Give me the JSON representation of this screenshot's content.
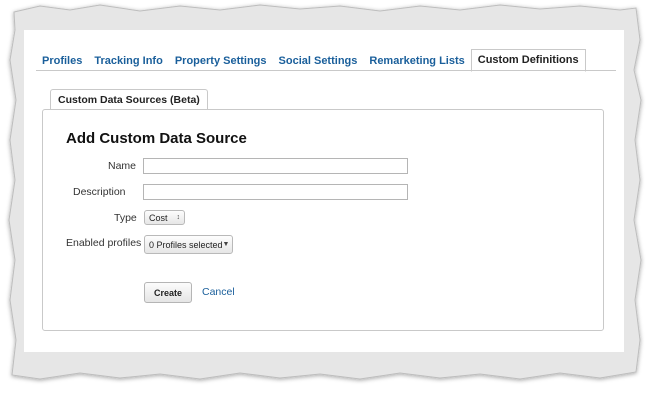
{
  "tabs": [
    {
      "label": "Profiles",
      "active": false
    },
    {
      "label": "Tracking Info",
      "active": false
    },
    {
      "label": "Property Settings",
      "active": false
    },
    {
      "label": "Social Settings",
      "active": false
    },
    {
      "label": "Remarketing Lists",
      "active": false
    },
    {
      "label": "Custom Definitions",
      "active": true
    }
  ],
  "subtab": {
    "label": "Custom Data Sources (Beta)"
  },
  "form": {
    "title": "Add Custom Data Source",
    "name_label": "Name",
    "name_value": "",
    "description_label": "Description",
    "description_value": "",
    "type_label": "Type",
    "type_value": "Cost",
    "profiles_label": "Enabled profiles",
    "profiles_value": "0 Profiles selected",
    "create_label": "Create",
    "cancel_label": "Cancel"
  },
  "colors": {
    "link": "#1a5f9b",
    "border": "#c9c9c9"
  },
  "icons": {
    "select_arrow": "chevron-down-icon",
    "stepper_arrow": "up-down-arrows-icon"
  }
}
